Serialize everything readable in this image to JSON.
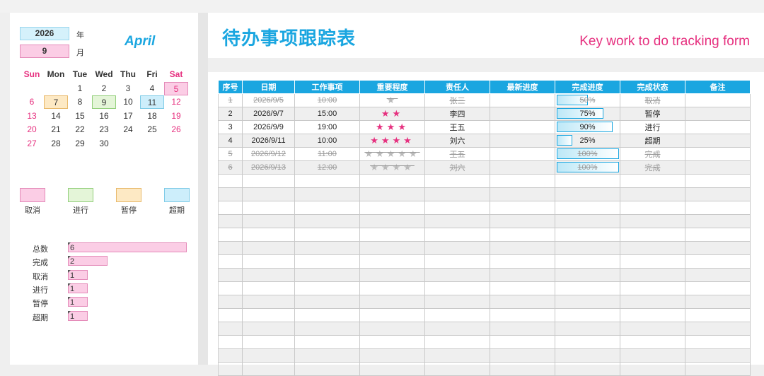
{
  "header": {
    "title": "待办事项跟踪表",
    "subtitle": "Key work to do tracking form"
  },
  "date": {
    "year": "2026",
    "year_suffix": "年",
    "month_num": "9",
    "month_suffix": "月",
    "month_name": "April"
  },
  "calendar": {
    "weekdays": [
      "Sun",
      "Mon",
      "Tue",
      "Wed",
      "Thu",
      "Fri",
      "Sat"
    ],
    "weeks": [
      [
        "",
        "",
        "1",
        "2",
        "3",
        "4",
        "5"
      ],
      [
        "6",
        "7",
        "8",
        "9",
        "10",
        "11",
        "12"
      ],
      [
        "13",
        "14",
        "15",
        "16",
        "17",
        "18",
        "19"
      ],
      [
        "20",
        "21",
        "22",
        "23",
        "24",
        "25",
        "26"
      ],
      [
        "27",
        "28",
        "29",
        "30",
        "",
        "",
        ""
      ]
    ]
  },
  "legend": [
    {
      "label": "取消",
      "color": "#fbcde5"
    },
    {
      "label": "进行",
      "color": "#e4f5d8"
    },
    {
      "label": "暂停",
      "color": "#fde9c4"
    },
    {
      "label": "超期",
      "color": "#cdeefb"
    }
  ],
  "stats": [
    {
      "label": "总数",
      "value": "6"
    },
    {
      "label": "完成",
      "value": "2"
    },
    {
      "label": "取消",
      "value": "1"
    },
    {
      "label": "进行",
      "value": "1"
    },
    {
      "label": "暂停",
      "value": "1"
    },
    {
      "label": "超期",
      "value": "1"
    }
  ],
  "table": {
    "columns": [
      "序号",
      "日期",
      "工作事项",
      "重要程度",
      "责任人",
      "最新进度",
      "完成进度",
      "完成状态",
      "备注"
    ],
    "rows": [
      {
        "no": "1",
        "date": "2026/9/5",
        "time": "10:00",
        "stars": "★",
        "owner": "张三",
        "latest": "",
        "progress": "50%",
        "progress_value": 0.5,
        "status": "取消",
        "note": "",
        "cancel": true
      },
      {
        "no": "2",
        "date": "2026/9/7",
        "time": "15:00",
        "stars": "★★",
        "owner": "李四",
        "latest": "",
        "progress": "75%",
        "progress_value": 0.75,
        "status": "暂停",
        "note": "",
        "cancel": false
      },
      {
        "no": "3",
        "date": "2026/9/9",
        "time": "19:00",
        "stars": "★★★",
        "owner": "王五",
        "latest": "",
        "progress": "90%",
        "progress_value": 0.9,
        "status": "进行",
        "note": "",
        "cancel": false
      },
      {
        "no": "4",
        "date": "2026/9/11",
        "time": "10:00",
        "stars": "★★★★",
        "owner": "刘六",
        "latest": "",
        "progress": "25%",
        "progress_value": 0.25,
        "status": "超期",
        "note": "",
        "cancel": false
      },
      {
        "no": "5",
        "date": "2026/9/12",
        "time": "11:00",
        "stars": "★★★★★",
        "owner": "王五",
        "latest": "",
        "progress": "100%",
        "progress_value": 1.0,
        "status": "完成",
        "note": "",
        "cancel": true
      },
      {
        "no": "6",
        "date": "2026/9/13",
        "time": "12:00",
        "stars": "★★★★",
        "owner": "刘六",
        "latest": "",
        "progress": "100%",
        "progress_value": 1.0,
        "status": "完成",
        "note": "",
        "cancel": true
      }
    ]
  }
}
